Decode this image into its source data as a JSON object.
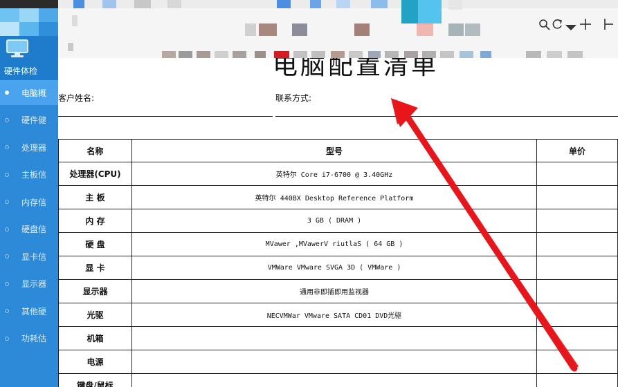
{
  "sidebar": {
    "title": "硬件体检",
    "items": [
      {
        "label": "电脑概",
        "active": true
      },
      {
        "label": "硬件健",
        "active": false
      },
      {
        "label": "处理器",
        "active": false
      },
      {
        "label": "主板信",
        "active": false
      },
      {
        "label": "内存信",
        "active": false
      },
      {
        "label": "硬盘信",
        "active": false
      },
      {
        "label": "显卡信",
        "active": false
      },
      {
        "label": "显示器",
        "active": false
      },
      {
        "label": "其他硬",
        "active": false
      },
      {
        "label": "功耗估",
        "active": false
      }
    ]
  },
  "toolbar": {
    "search_icon": "search-icon",
    "refresh_icon": "refresh-icon",
    "add_icon": "plus-icon"
  },
  "document": {
    "title": "电脑配置清单",
    "customer_label": "客户姓名:",
    "contact_label": "联系方式:",
    "table": {
      "headers": [
        "名称",
        "型号",
        "单价"
      ],
      "rows": [
        {
          "name": "处理器(CPU)",
          "model": "英特尔 Core i7-6700 @ 3.40GHz",
          "price": ""
        },
        {
          "name": "主 板",
          "model": "英特尔 440BX Desktop Reference Platform",
          "price": ""
        },
        {
          "name": "内 存",
          "model": "3 GB ( DRAM )",
          "price": ""
        },
        {
          "name": "硬 盘",
          "model": "MVawer ,MVawerV riutlaS ( 64 GB )",
          "price": ""
        },
        {
          "name": "显 卡",
          "model": "VMWare VMware SVGA 3D ( VMWare )",
          "price": ""
        },
        {
          "name": "显示器",
          "model": "通用非即插即用监视器",
          "price": ""
        },
        {
          "name": "光驱",
          "model": "NECVMWar VMware SATA CD01 DVD光驱",
          "price": ""
        },
        {
          "name": "机箱",
          "model": "",
          "price": ""
        },
        {
          "name": "电源",
          "model": "",
          "price": ""
        },
        {
          "name": "键盘/鼠标",
          "model": "",
          "price": ""
        }
      ]
    }
  },
  "colors": {
    "sidebar": "#2d8ad8",
    "sidebar_active": "#4aa3ee",
    "arrow": "#e8161b"
  }
}
